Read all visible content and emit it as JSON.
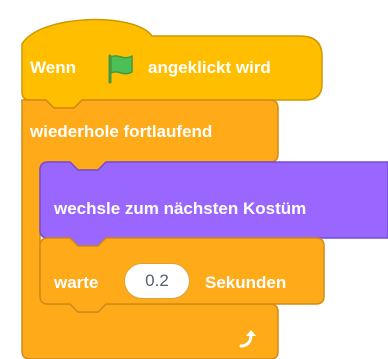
{
  "colors": {
    "events": "#FFBF00",
    "events_border": "#CC9900",
    "control": "#FFAB19",
    "control_border": "#CF8B17",
    "looks": "#9966FF",
    "looks_border": "#774DCB",
    "flag_green": "#4CBF56",
    "text": "#FFFFFF",
    "input_text": "#575E75"
  },
  "event_block": {
    "prefix": "Wenn",
    "icon": "green-flag-icon",
    "suffix": "angeklickt wird"
  },
  "forever_block": {
    "label": "wiederhole fortlaufend",
    "loop_icon": "loop-arrow-icon"
  },
  "costume_block": {
    "label": "wechsle zum nächsten Kostüm"
  },
  "wait_block": {
    "prefix": "warte",
    "value": "0.2",
    "suffix": "Sekunden"
  }
}
